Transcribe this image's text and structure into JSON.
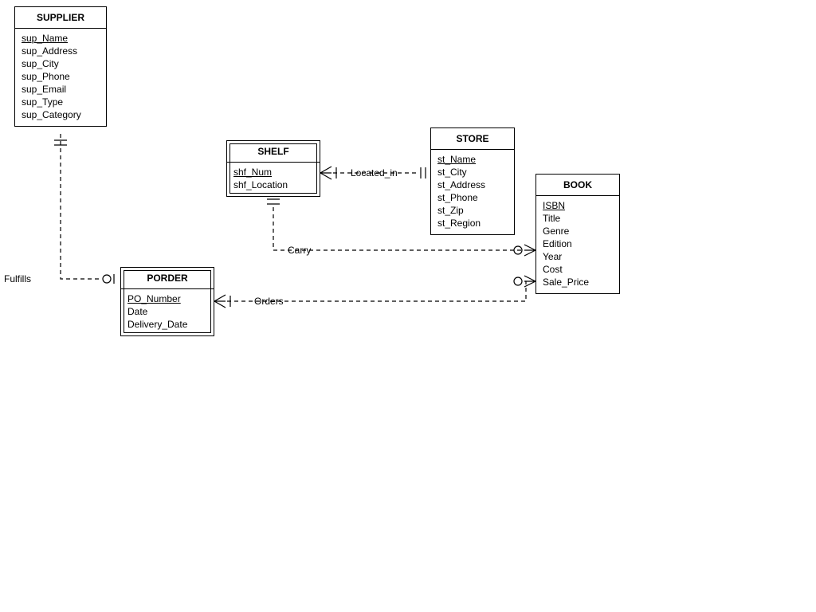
{
  "entities": {
    "supplier": {
      "title": "SUPPLIER",
      "attrs": [
        "sup_Name",
        "sup_Address",
        "sup_City",
        "sup_Phone",
        "sup_Email",
        "sup_Type",
        "sup_Category"
      ],
      "pkIndex": 0,
      "weak": false
    },
    "shelf": {
      "title": "SHELF",
      "attrs": [
        "shf_Num",
        "shf_Location"
      ],
      "pkIndex": 0,
      "weak": true
    },
    "store": {
      "title": "STORE",
      "attrs": [
        "st_Name",
        "st_City",
        "st_Address",
        "st_Phone",
        "st_Zip",
        "st_Region"
      ],
      "pkIndex": 0,
      "weak": false
    },
    "book": {
      "title": "BOOK",
      "attrs": [
        "ISBN",
        "Title",
        "Genre",
        "Edition",
        "Year",
        "Cost",
        "Sale_Price"
      ],
      "pkIndex": 0,
      "weak": false
    },
    "porder": {
      "title": "PORDER",
      "attrs": [
        "PO_Number",
        "Date",
        "Delivery_Date"
      ],
      "pkIndex": 0,
      "weak": true
    }
  },
  "relationships": {
    "fulfills": "Fulfills",
    "located_in": "Located_in",
    "carry": "Carry",
    "orders": "Orders"
  }
}
